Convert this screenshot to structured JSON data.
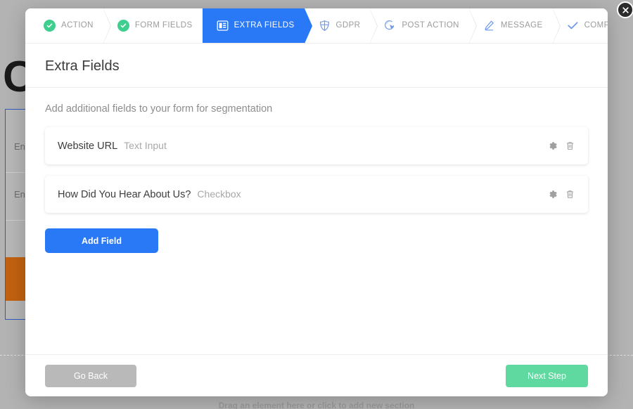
{
  "background": {
    "letter": "C",
    "field_rows": [
      "En",
      "En"
    ],
    "bottom_hint": "Drag an element here or click to add new section"
  },
  "modal": {
    "close_icon": "close-icon",
    "steps": [
      {
        "label": "ACTION",
        "icon": "check-circle-icon",
        "state": "done"
      },
      {
        "label": "FORM FIELDS",
        "icon": "check-circle-icon",
        "state": "done"
      },
      {
        "label": "EXTRA FIELDS",
        "icon": "form-layout-icon",
        "state": "active"
      },
      {
        "label": "GDPR",
        "icon": "shield-icon",
        "state": "upcoming"
      },
      {
        "label": "POST ACTION",
        "icon": "cursor-click-icon",
        "state": "upcoming"
      },
      {
        "label": "MESSAGE",
        "icon": "pencil-icon",
        "state": "upcoming"
      },
      {
        "label": "COMPLETE",
        "icon": "checkmark-icon",
        "state": "upcoming"
      }
    ],
    "title": "Extra Fields",
    "subtitle": "Add additional fields to your form for segmentation",
    "fields": [
      {
        "label": "Website URL",
        "type": "Text Input",
        "settings_icon": "gear-icon",
        "delete_icon": "trash-icon"
      },
      {
        "label": "How Did You Hear About Us?",
        "type": "Checkbox",
        "settings_icon": "gear-icon",
        "delete_icon": "trash-icon"
      }
    ],
    "add_field_label": "Add Field",
    "footer": {
      "back_label": "Go Back",
      "next_label": "Next Step"
    },
    "colors": {
      "active_step": "#2979f7",
      "done_step": "#3ecf8e",
      "primary_button": "#2979f7",
      "next_button": "#5fd9a0",
      "back_button": "#b9b9b9"
    }
  }
}
